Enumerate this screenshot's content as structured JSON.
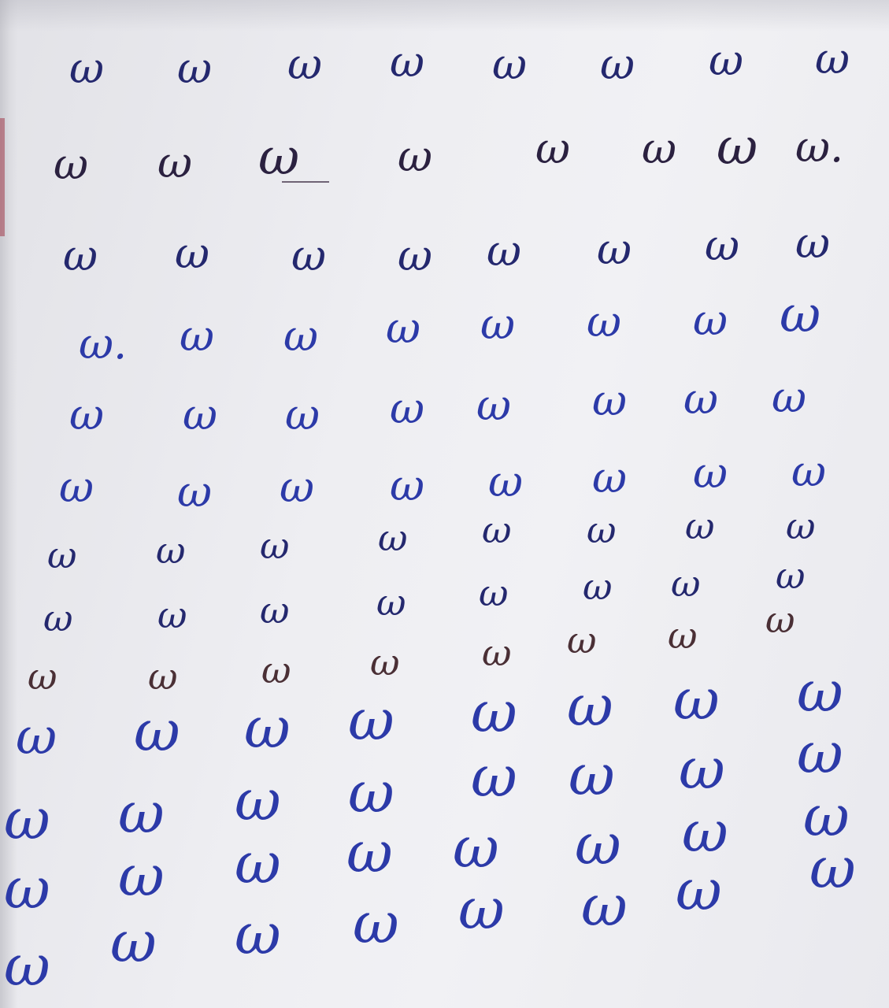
{
  "sheet": {
    "ink_colors": {
      "blue": "#2c3aa8",
      "navy": "#24286e",
      "brown": "#4a2f35",
      "dark": "#2b2140"
    },
    "rows": [
      [
        "ω",
        "ω",
        "ω",
        "ω",
        "ω",
        "ω",
        "ω",
        "ω"
      ],
      [
        "ω",
        "ω",
        "ω",
        "ω",
        "ω",
        "ω",
        "ω",
        "ω."
      ],
      [
        "ω",
        "ω",
        "ω",
        "ω",
        "ω",
        "ω",
        "ω",
        "ω"
      ],
      [
        "ω.",
        "ω",
        "ω",
        "ω",
        "ω",
        "ω",
        "ω",
        "ω"
      ],
      [
        "ω",
        "ω",
        "ω",
        "ω",
        "ω",
        "ω",
        "ω",
        "ω"
      ],
      [
        "ω",
        "ω",
        "ω",
        "ω",
        "ω",
        "ω",
        "ω",
        "ω"
      ],
      [
        "ω",
        "ω",
        "ω",
        "ω",
        "ω",
        "ω",
        "ω",
        "ω"
      ],
      [
        "ω",
        "ω",
        "ω",
        "ω",
        "ω",
        "ω",
        "ω",
        "ω"
      ],
      [
        "ω",
        "ω",
        "ω",
        "ω",
        "ω",
        "ω",
        "ω"
      ],
      [
        "ω",
        "ω",
        "ω",
        "ω",
        "ω",
        "ω",
        "ω",
        "ω"
      ],
      [
        "ω",
        "ω",
        "ω",
        "ω",
        "ω",
        "ω",
        "ω",
        "ω"
      ],
      [
        "ω",
        "ω",
        "ω",
        "ω",
        "ω",
        "ω",
        "ω",
        "ω"
      ],
      [
        "ω",
        "ω",
        "ω",
        "ω",
        "ω",
        "ω",
        "ω"
      ]
    ]
  }
}
